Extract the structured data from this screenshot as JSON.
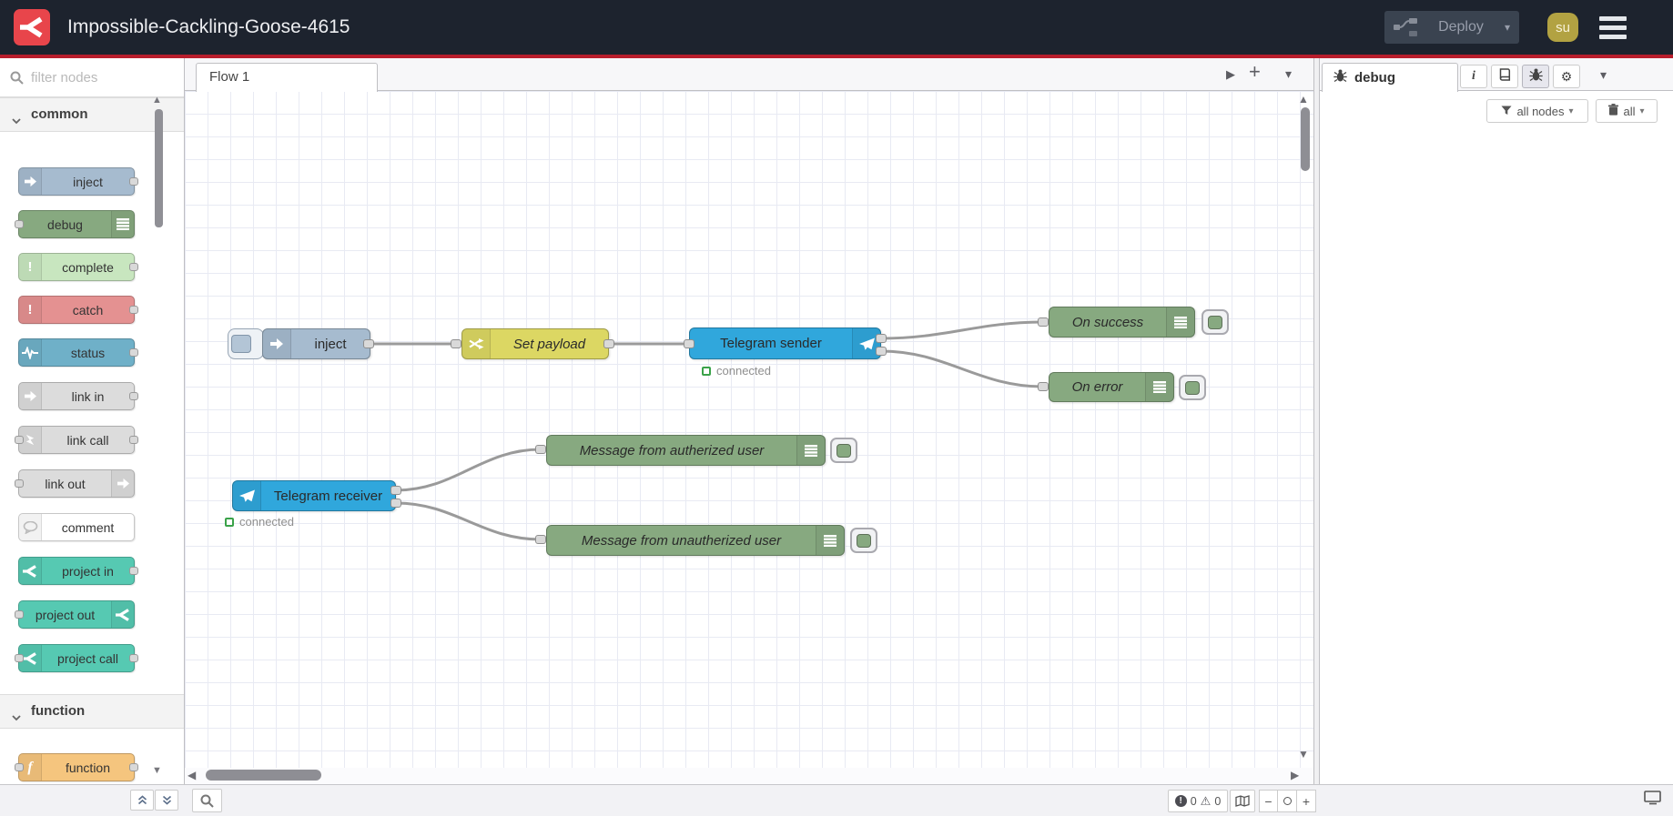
{
  "header": {
    "title": "Impossible-Cackling-Goose-4615",
    "deploy_label": "Deploy",
    "avatar_text": "su"
  },
  "palette": {
    "search_placeholder": "filter nodes",
    "categories": [
      {
        "label": "common",
        "items": [
          {
            "label": "inject"
          },
          {
            "label": "debug"
          },
          {
            "label": "complete"
          },
          {
            "label": "catch"
          },
          {
            "label": "status"
          },
          {
            "label": "link in"
          },
          {
            "label": "link call"
          },
          {
            "label": "link out"
          },
          {
            "label": "comment"
          },
          {
            "label": "project in"
          },
          {
            "label": "project out"
          },
          {
            "label": "project call"
          }
        ]
      },
      {
        "label": "function",
        "items": [
          {
            "label": "function"
          }
        ]
      }
    ]
  },
  "workspace": {
    "tab_label": "Flow 1",
    "nodes": {
      "inject": {
        "label": "inject"
      },
      "change": {
        "label": "Set payload"
      },
      "sender": {
        "label": "Telegram sender",
        "status": "connected"
      },
      "on_success": {
        "label": "On success"
      },
      "on_error": {
        "label": "On error"
      },
      "receiver": {
        "label": "Telegram receiver",
        "status": "connected"
      },
      "msg_auth": {
        "label": "Message from autherized user"
      },
      "msg_unauth": {
        "label": "Message from unautherized user"
      }
    },
    "footer": {
      "error_count": "0",
      "warning_count": "0"
    }
  },
  "sidebar": {
    "tab_label": "debug",
    "filter_label": "all nodes",
    "clear_label": "all"
  },
  "icons": {
    "caret_down": "▾",
    "plus": "+",
    "minus": "−",
    "scroll_up": "▲",
    "scroll_down": "▼",
    "scroll_left": "◀",
    "scroll_right": "▶",
    "warning": "⚠",
    "exclamation": "!",
    "info": "i",
    "gear": "⚙"
  },
  "colors": {
    "header_bg": "#1d232e",
    "accent_red": "#b81d2c",
    "logo_red": "#e8454b",
    "avatar_gold": "#b2a242",
    "inject_blue": "#a6bbcf",
    "debug_green": "#87a980",
    "complete_green": "#c8e6bf",
    "catch_red": "#e49191",
    "status_blue": "#6fb0c8",
    "link_gray": "#dcdcdc",
    "comment_white": "#ffffff",
    "project_teal": "#56c9b2",
    "function_orange": "#f5c57e",
    "change_yellow": "#dcd763",
    "telegram_blue": "#30a7dc",
    "status_connected_green": "#3aa249",
    "wire_gray": "#9a9a9a"
  }
}
